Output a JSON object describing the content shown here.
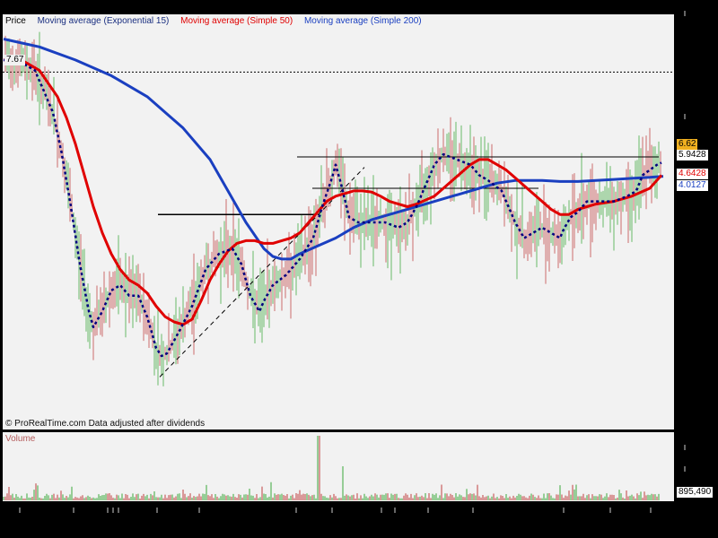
{
  "legend": {
    "price": "Price",
    "ema15": "Moving average (Exponential 15)",
    "sma50": "Moving average (Simple 50)",
    "sma200": "Moving average (Simple 200)"
  },
  "watermark": "© ProRealTime.com  Data adjusted after dividends",
  "volume_label": "Volume",
  "colors": {
    "background": "#000000",
    "panel": "#f2f2f2",
    "ema15": "#000080",
    "sma50": "#e00000",
    "sma200": "#1a3fc0",
    "up_candle": "#3aa83a",
    "down_candle": "#c04040",
    "last_price_tag": "#f0b020"
  },
  "chart_data": {
    "type": "line",
    "ylim": [
      1.0,
      8.6
    ],
    "grid": false,
    "legend_position": "top-left",
    "reference_line": {
      "value": "7.67",
      "style": "dotted"
    },
    "value_tags": [
      {
        "label": "6.62",
        "series": "Price",
        "value": 6.62
      },
      {
        "label": "5.9428",
        "series": "Moving average (Exponential 15)",
        "value": 5.9428
      },
      {
        "label": "4.6428",
        "series": "Moving average (Simple 50)",
        "value": 4.6428
      },
      {
        "label": "4.0127",
        "series": "Moving average (Simple 200)",
        "value": 4.0127
      },
      {
        "label": "895,490",
        "series": "Volume",
        "value": 895490
      }
    ],
    "series": [
      {
        "name": "Moving average (Exponential 15)",
        "style": "dotted",
        "x": [
          0,
          20,
          35,
          45,
          55,
          65,
          75,
          85,
          95,
          100,
          110,
          120,
          130,
          140,
          150,
          160,
          170,
          176,
          182,
          195,
          210,
          225,
          240,
          255,
          265,
          275,
          285,
          290,
          300,
          315,
          330,
          345,
          355,
          365,
          370,
          375,
          385,
          395,
          410,
          425,
          440,
          450,
          460,
          470,
          480,
          490,
          505,
          520,
          530,
          540,
          555,
          570,
          580,
          590,
          600,
          610,
          620,
          625,
          632,
          640,
          650,
          665,
          680,
          695,
          705,
          712,
          720,
          728,
          733
        ],
        "y": [
          7.9,
          7.85,
          7.7,
          7.3,
          6.9,
          6.1,
          5.1,
          4.0,
          3.1,
          2.8,
          3.1,
          3.5,
          3.6,
          3.4,
          3.4,
          3.0,
          2.4,
          2.25,
          2.3,
          2.7,
          3.2,
          3.9,
          4.2,
          4.3,
          4.0,
          3.4,
          3.1,
          3.3,
          3.6,
          3.8,
          4.1,
          4.5,
          5.1,
          5.6,
          5.9,
          5.6,
          4.9,
          4.8,
          4.8,
          4.8,
          4.7,
          4.8,
          5.1,
          5.5,
          5.9,
          6.1,
          6.0,
          5.9,
          5.7,
          5.6,
          5.4,
          4.8,
          4.5,
          4.6,
          4.7,
          4.6,
          4.5,
          4.7,
          4.9,
          5.0,
          5.2,
          5.2,
          5.2,
          5.3,
          5.4,
          5.7,
          5.8,
          5.9,
          5.94
        ]
      },
      {
        "name": "Moving average (Simple 50)",
        "style": "solid",
        "x": [
          0,
          20,
          40,
          60,
          70,
          80,
          90,
          100,
          110,
          120,
          130,
          140,
          150,
          160,
          170,
          180,
          190,
          200,
          210,
          220,
          230,
          240,
          250,
          260,
          270,
          280,
          290,
          300,
          310,
          320,
          330,
          340,
          350,
          360,
          370,
          380,
          390,
          400,
          410,
          420,
          430,
          440,
          450,
          460,
          480,
          500,
          520,
          530,
          540,
          550,
          560,
          570,
          580,
          590,
          600,
          610,
          620,
          630,
          640,
          650,
          660,
          680,
          700,
          720,
          733
        ],
        "y": [
          7.9,
          7.9,
          7.7,
          7.2,
          6.8,
          6.3,
          5.7,
          5.1,
          4.6,
          4.2,
          3.9,
          3.7,
          3.6,
          3.45,
          3.2,
          3.0,
          2.9,
          2.85,
          2.95,
          3.3,
          3.7,
          4.0,
          4.25,
          4.4,
          4.45,
          4.45,
          4.4,
          4.4,
          4.45,
          4.5,
          4.6,
          4.8,
          5.0,
          5.2,
          5.3,
          5.35,
          5.4,
          5.4,
          5.38,
          5.3,
          5.2,
          5.15,
          5.1,
          5.15,
          5.3,
          5.6,
          5.9,
          6.0,
          6.0,
          5.9,
          5.8,
          5.65,
          5.5,
          5.35,
          5.2,
          5.05,
          4.95,
          4.95,
          5.05,
          5.1,
          5.15,
          5.2,
          5.3,
          5.45,
          5.7
        ]
      },
      {
        "name": "Moving average (Simple 200)",
        "style": "solid",
        "x": [
          0,
          40,
          80,
          120,
          160,
          200,
          230,
          250,
          270,
          290,
          300,
          310,
          320,
          330,
          350,
          370,
          390,
          410,
          430,
          450,
          470,
          490,
          510,
          530,
          550,
          570,
          590,
          600,
          620,
          640,
          660,
          680,
          700,
          720,
          735
        ],
        "y": [
          8.3,
          8.15,
          7.9,
          7.6,
          7.2,
          6.6,
          6.0,
          5.4,
          4.8,
          4.3,
          4.15,
          4.1,
          4.1,
          4.2,
          4.35,
          4.5,
          4.7,
          4.85,
          4.95,
          5.05,
          5.15,
          5.25,
          5.35,
          5.45,
          5.55,
          5.6,
          5.6,
          5.6,
          5.58,
          5.58,
          5.6,
          5.62,
          5.64,
          5.66,
          5.68
        ]
      }
    ]
  }
}
